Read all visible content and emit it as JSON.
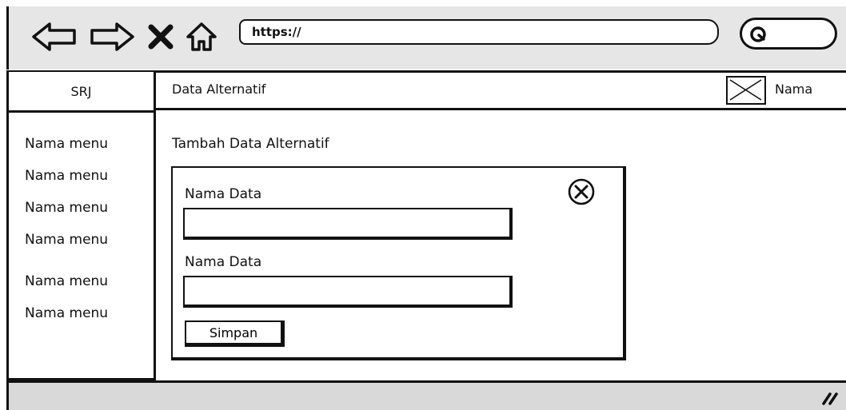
{
  "browser": {
    "url": "https://"
  },
  "sidebar": {
    "brand": "SRJ",
    "items": [
      {
        "label": "Nama menu"
      },
      {
        "label": "Nama menu"
      },
      {
        "label": "Nama menu"
      },
      {
        "label": "Nama menu"
      },
      {
        "label": "Nama menu"
      },
      {
        "label": "Nama menu"
      }
    ]
  },
  "topbar": {
    "title": "Data Alternatif",
    "user_name": "Nama"
  },
  "main": {
    "page_title": "Tambah Data Alternatif",
    "form": {
      "field1_label": "Nama Data",
      "field1_value": "",
      "field2_label": "Nama Data",
      "field2_value": "",
      "submit_label": "Simpan"
    }
  },
  "icons": {
    "back": "arrow-left-icon",
    "forward": "arrow-right-icon",
    "stop": "close-x-icon",
    "home": "home-icon",
    "search": "search-icon",
    "avatar": "image-placeholder-icon",
    "modal_close": "circle-x-icon",
    "resize": "resize-grip-icon"
  },
  "colors": {
    "chrome": "#e6e6e6",
    "status": "#d9d9d9",
    "stroke": "#111111",
    "background": "#ffffff"
  }
}
